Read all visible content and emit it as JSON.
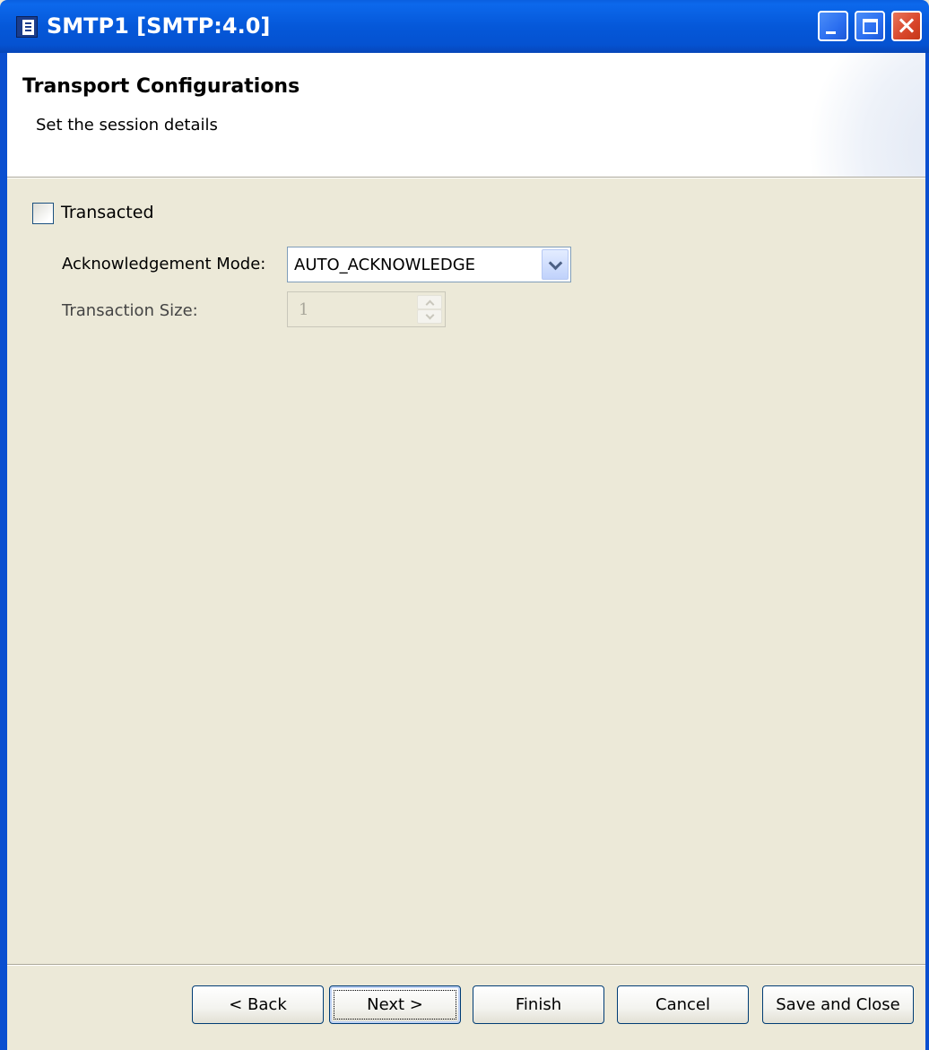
{
  "window": {
    "title": "SMTP1 [SMTP:4.0]"
  },
  "header": {
    "title": "Transport Configurations",
    "subtitle": "Set the session details"
  },
  "form": {
    "transacted": {
      "label": "Transacted",
      "checked": false
    },
    "acknowledgement_mode": {
      "label": "Acknowledgement Mode:",
      "value": "AUTO_ACKNOWLEDGE"
    },
    "transaction_size": {
      "label": "Transaction Size:",
      "value": "1",
      "enabled": false
    }
  },
  "buttons": {
    "back": "< Back",
    "next": "Next >",
    "finish": "Finish",
    "cancel": "Cancel",
    "save_and_close": "Save and Close"
  },
  "icons": {
    "app": "app-icon",
    "minimize": "minimize-icon",
    "maximize": "maximize-icon",
    "close": "close-icon",
    "dropdown": "chevron-down-icon",
    "spin_up": "chevron-up-icon",
    "spin_down": "chevron-down-icon"
  },
  "colors": {
    "titlebar": "#0558d9",
    "background": "#ece9d8",
    "close_button": "#d8452a"
  }
}
